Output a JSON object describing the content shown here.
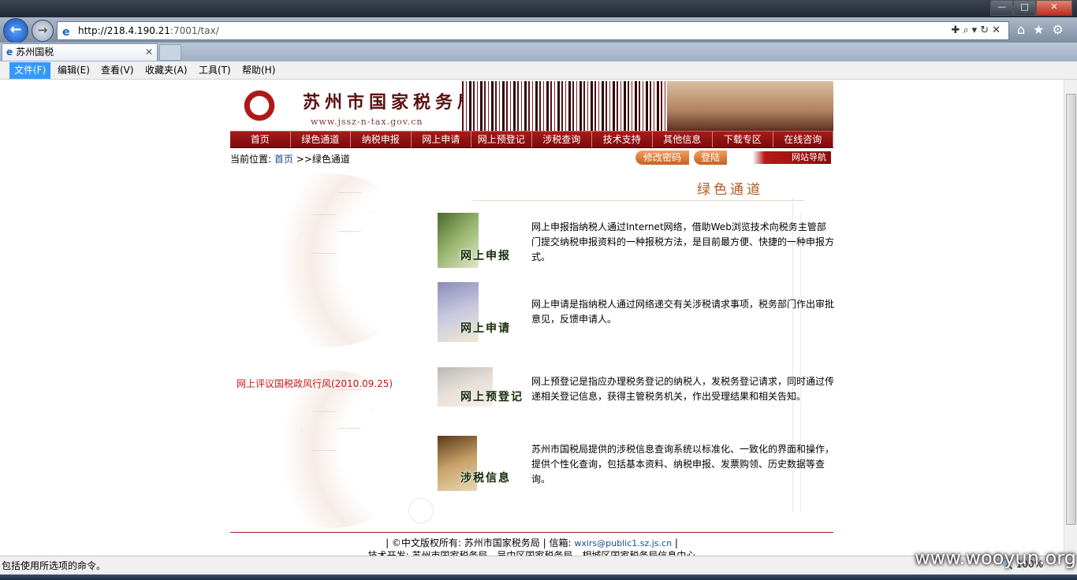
{
  "browser": {
    "url_host": "http://218.4.190.21",
    "url_path": ":7001/tax/",
    "tab_title": "苏州国税",
    "menu": [
      "文件(F)",
      "编辑(E)",
      "查看(V)",
      "收藏夹(A)",
      "工具(T)",
      "帮助(H)"
    ],
    "status_text": "包括使用所选项的命令。",
    "zoom": "100%",
    "window_buttons": [
      "—",
      "□",
      "✕"
    ]
  },
  "header": {
    "site_title": "苏州市国家税务局",
    "site_url": "www.jssz-n-tax.gov.cn"
  },
  "nav": [
    "首页",
    "绿色通道",
    "纳税申报",
    "网上申请",
    "网上预登记",
    "涉税查询",
    "技术支持",
    "其他信息",
    "下载专区",
    "在线咨询"
  ],
  "breadcrumb": {
    "prefix": "当前位置:",
    "home": "首页",
    "current": ">>绿色通道"
  },
  "buttons": {
    "change_password": "修改密码",
    "login": "登陆",
    "site_nav": "网站导航"
  },
  "section_title": "绿色通道",
  "side_link": "网上评议国税政风行风(2010.09.25)",
  "services": [
    {
      "label": "网上申报",
      "desc": "网上申报指纳税人通过Internet网络，借助Web浏览技术向税务主管部门提交纳税申报资料的一种报税方法，是目前最方便、快捷的一种申报方式。"
    },
    {
      "label": "网上申请",
      "desc": "网上申请是指纳税人通过网络递交有关涉税请求事项，税务部门作出审批意见，反馈申请人。"
    },
    {
      "label": "网上预登记",
      "desc": "网上预登记是指应办理税务登记的纳税人，发税务登记请求，同时通过传递相关登记信息，获得主管税务机关，作出受理结果和相关告知。"
    },
    {
      "label": "涉税信息",
      "desc": "苏州市国税局提供的涉税信息查询系统以标准化、一致化的界面和操作，提供个性化查询，包括基本资料、纳税申报、发票购领、历史数据等查询。"
    }
  ],
  "footer": {
    "copyright": "| ©中文版权所有: 苏州市国家税务局 | 信箱:",
    "email": "wxirs@public1.sz.js.cn",
    "end": "|",
    "tech": "技术开发: 苏州市国家税务局、吴中区国家税务局、相城区国家税务局信息中心"
  },
  "watermark": "www.wooyun.org",
  "colors": {
    "accent": "#a81a1a",
    "link": "#1a4a8a",
    "side_link": "#c41818",
    "title": "#b05a20"
  }
}
